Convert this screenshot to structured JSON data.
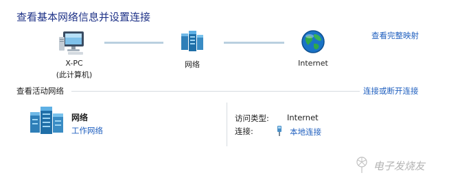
{
  "header": {
    "title": "查看基本网络信息并设置连接",
    "view_full_map": "查看完整映射"
  },
  "network_map": {
    "nodes": [
      {
        "label_line1": "X-PC",
        "label_line2": "(此计算机)",
        "icon": "computer-icon"
      },
      {
        "label_line1": "网络",
        "icon": "network-icon"
      },
      {
        "label_line1": "Internet",
        "icon": "globe-icon"
      }
    ]
  },
  "active_networks": {
    "section_title": "查看活动网络",
    "connect_link": "连接或断开连接",
    "network": {
      "name": "网络",
      "type": "工作网络",
      "icon": "work-network-icon",
      "access_type_label": "访问类型:",
      "access_type_value": "Internet",
      "connections_label": "连接:",
      "connections_value": "本地连接",
      "connection_icon": "ethernet-plug-icon"
    }
  },
  "watermark": {
    "text": "电子发烧友",
    "icon": "dandelion-logo-icon"
  },
  "colors": {
    "title": "#1e3287",
    "link": "#1f5fbf",
    "connector": "#b9d0df"
  }
}
